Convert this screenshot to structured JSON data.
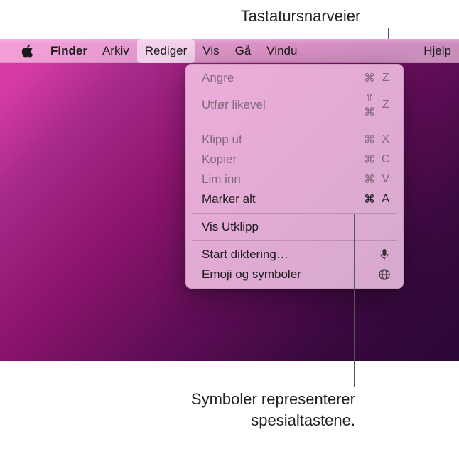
{
  "annotations": {
    "top": "Tastatursnarveier",
    "bottom_line1": "Symboler representerer",
    "bottom_line2": "spesialtastene."
  },
  "menubar": {
    "app_name": "Finder",
    "items": {
      "arkiv": "Arkiv",
      "rediger": "Rediger",
      "vis": "Vis",
      "ga": "Gå",
      "vindu": "Vindu",
      "hjelp": "Hjelp"
    }
  },
  "dropdown": {
    "angre": {
      "label": "Angre",
      "shortcut_syms": "⌘",
      "key": "Z"
    },
    "utfor": {
      "label": "Utfør likevel",
      "shortcut_syms": "⇧ ⌘",
      "key": "Z"
    },
    "klipp": {
      "label": "Klipp ut",
      "shortcut_syms": "⌘",
      "key": "X"
    },
    "kopier": {
      "label": "Kopier",
      "shortcut_syms": "⌘",
      "key": "C"
    },
    "lim": {
      "label": "Lim inn",
      "shortcut_syms": "⌘",
      "key": "V"
    },
    "marker": {
      "label": "Marker alt",
      "shortcut_syms": "⌘",
      "key": "A"
    },
    "vis_utklipp": {
      "label": "Vis Utklipp"
    },
    "diktering": {
      "label": "Start diktering…"
    },
    "emoji": {
      "label": "Emoji og symboler"
    }
  }
}
